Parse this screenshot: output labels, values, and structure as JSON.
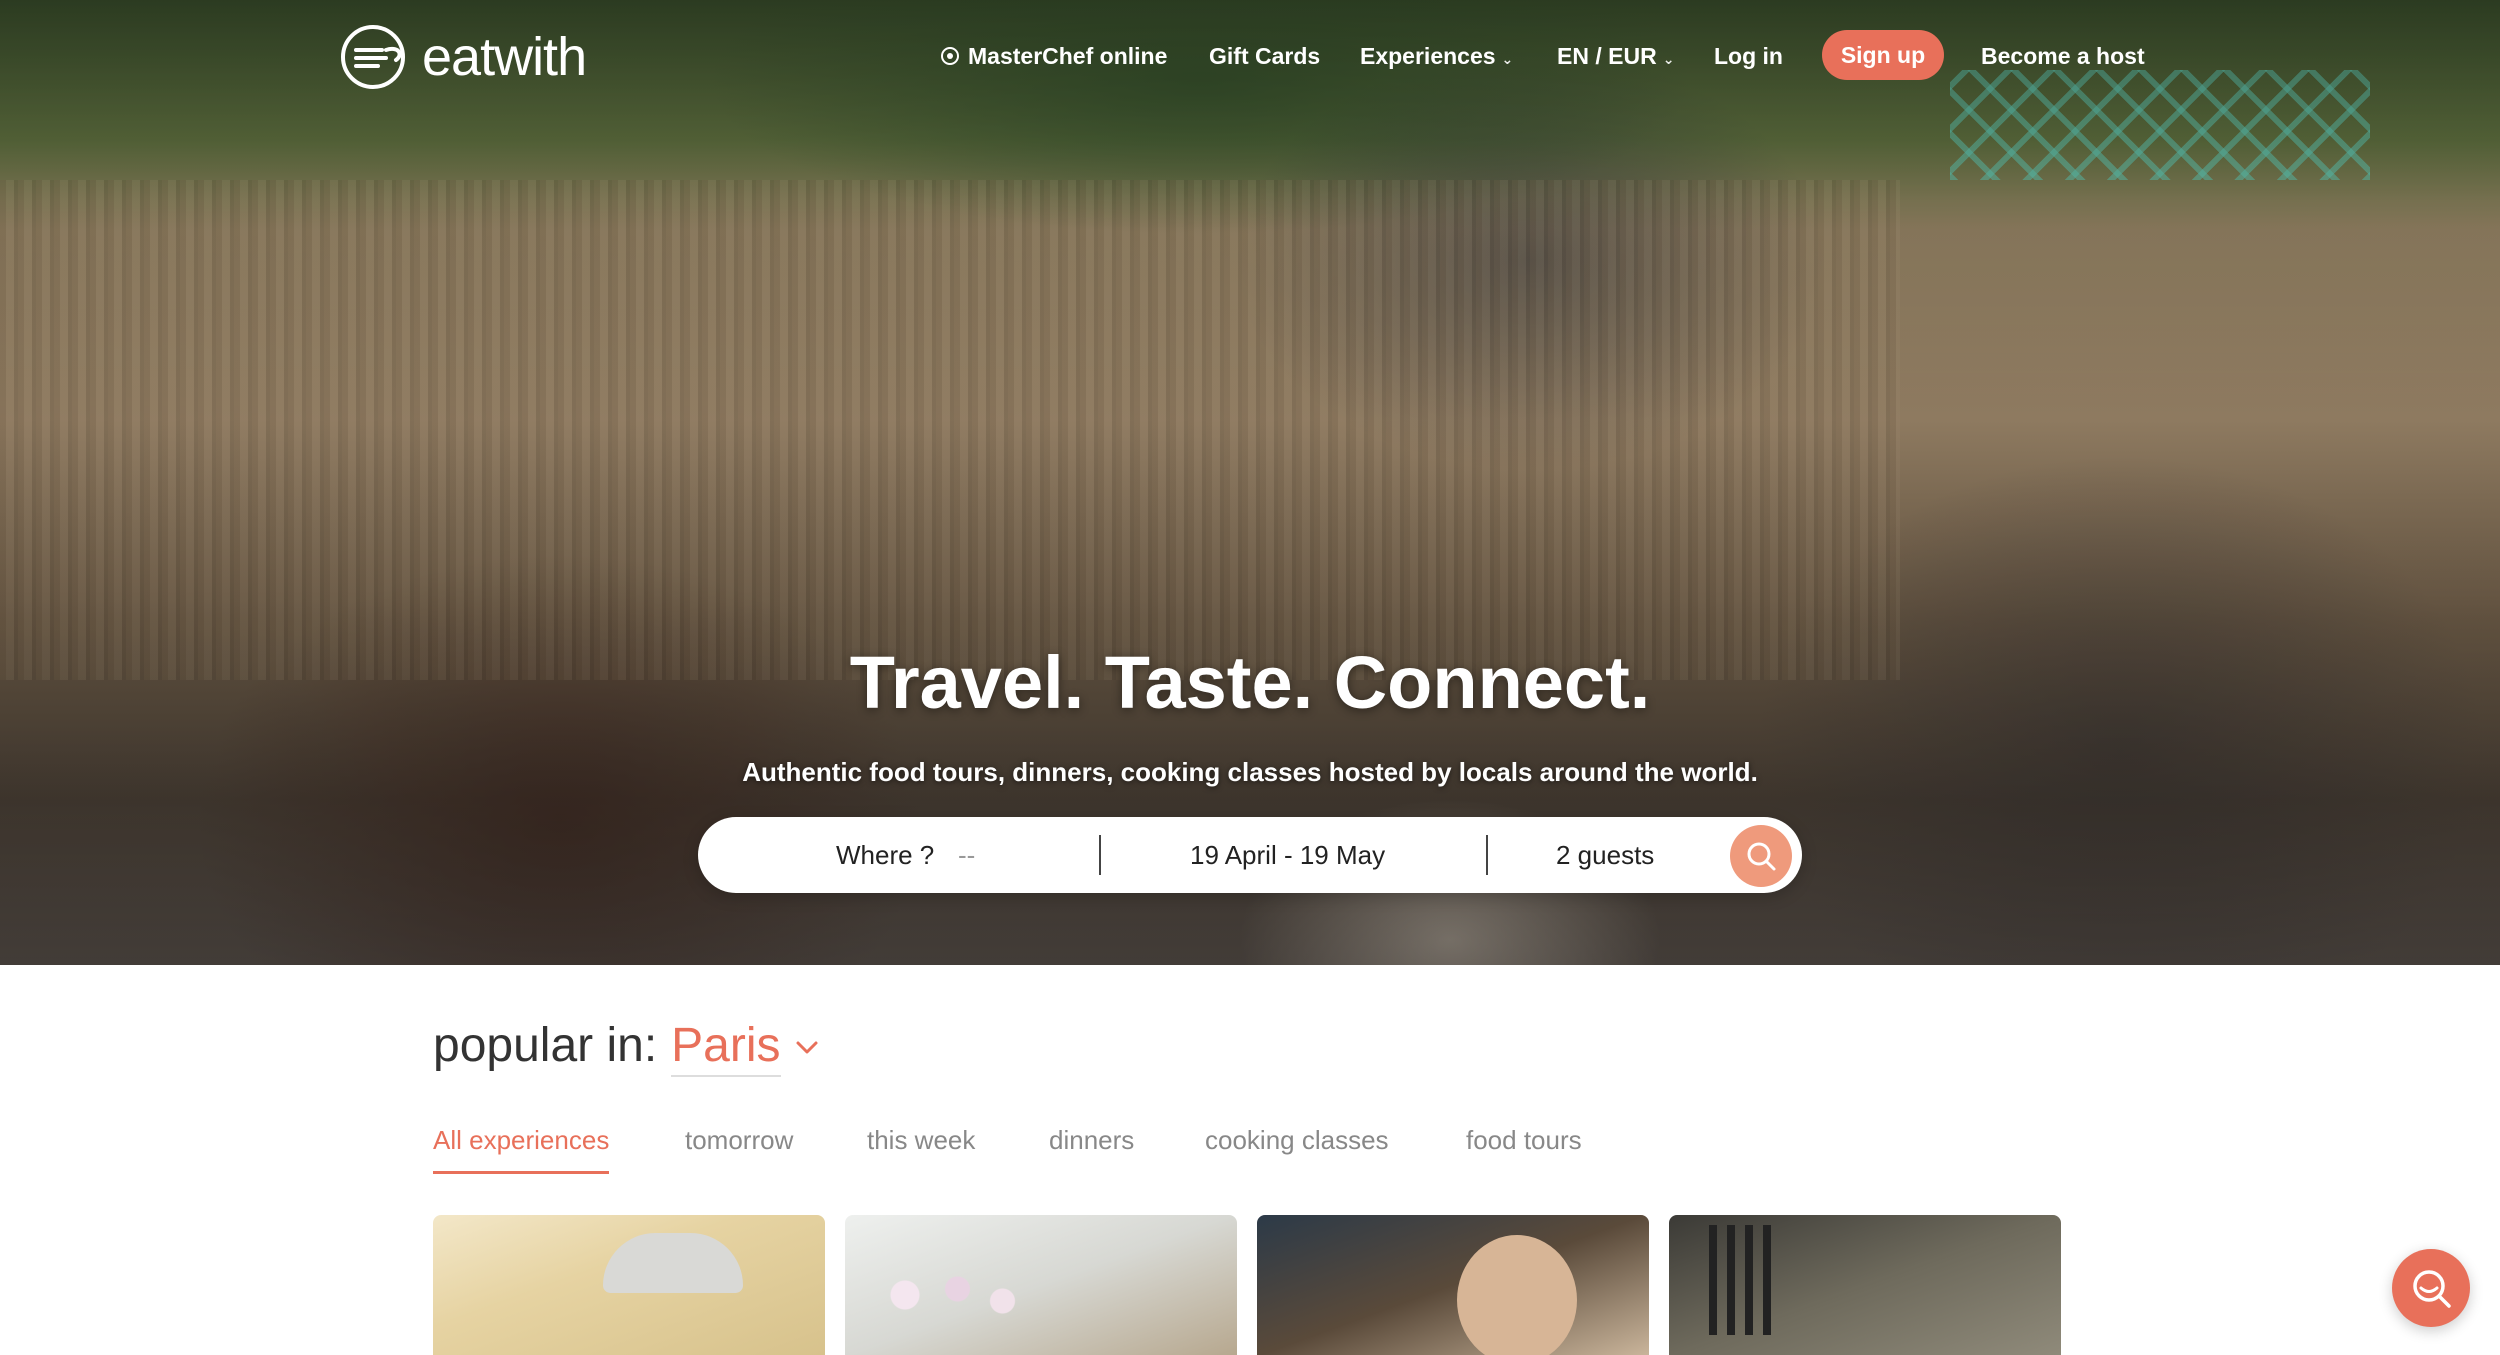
{
  "brand": {
    "name": "eatwith"
  },
  "nav": {
    "masterchef": "MasterChef online",
    "gift_cards": "Gift Cards",
    "experiences": "Experiences",
    "locale": "EN / EUR",
    "login": "Log in",
    "signup": "Sign up",
    "become_host": "Become a host"
  },
  "hero": {
    "title": "Travel. Taste. Connect.",
    "subtitle": "Authentic food tours, dinners, cooking classes hosted by locals around the world."
  },
  "search": {
    "where_label": "Where ?",
    "where_value": "--",
    "dates": "19 April - 19 May",
    "guests": "2 guests"
  },
  "popular": {
    "label": "popular in:",
    "city": "Paris"
  },
  "tabs": [
    {
      "label": "All experiences",
      "active": true
    },
    {
      "label": "tomorrow",
      "active": false
    },
    {
      "label": "this week",
      "active": false
    },
    {
      "label": "dinners",
      "active": false
    },
    {
      "label": "cooking classes",
      "active": false
    },
    {
      "label": "food tours",
      "active": false
    }
  ],
  "colors": {
    "accent": "#e8705a",
    "search_button": "#ef9a7c",
    "tab_inactive": "#888888"
  },
  "icons": {
    "logo": "eatwith-logo-icon",
    "masterchef": "masterchef-icon",
    "search": "search-icon",
    "chevron": "chevron-down-icon",
    "chat": "chat-search-icon"
  }
}
